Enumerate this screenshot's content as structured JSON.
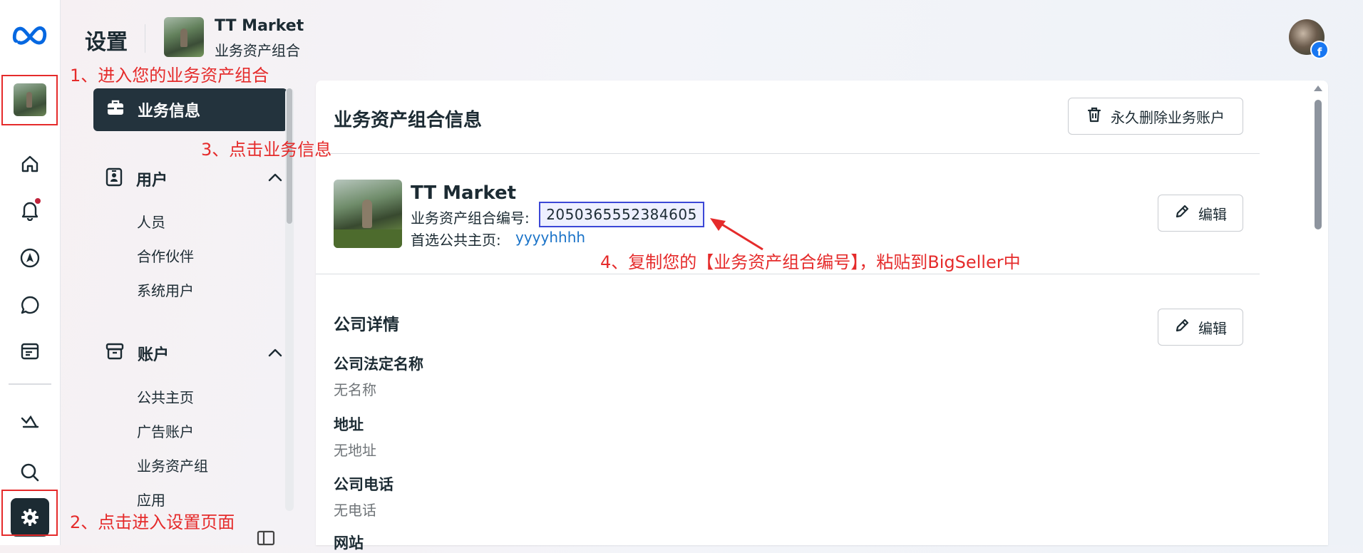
{
  "header": {
    "title": "设置",
    "business_name": "TT Market",
    "business_subtitle": "业务资产组合"
  },
  "settings_nav": {
    "active_item": "业务信息",
    "sections": [
      {
        "title": "用户",
        "items": [
          "人员",
          "合作伙伴",
          "系统用户"
        ]
      },
      {
        "title": "账户",
        "items": [
          "公共主页",
          "广告账户",
          "业务资产组",
          "应用"
        ]
      }
    ]
  },
  "card": {
    "title": "业务资产组合信息",
    "delete_button": "永久删除业务账户",
    "business_name": "TT Market",
    "id_label": "业务资产组合编号:",
    "id_value": "2050365552384605",
    "page_label": "首选公共主页:",
    "page_value": "yyyyhhhh",
    "edit_label": "编辑",
    "company_section_title": "公司详情",
    "fields": [
      {
        "label": "公司法定名称",
        "value": "无名称"
      },
      {
        "label": "地址",
        "value": "无地址"
      },
      {
        "label": "公司电话",
        "value": "无电话"
      },
      {
        "label": "网站",
        "value": ""
      }
    ]
  },
  "annotations": {
    "step1": "1、进入您的业务资产组合",
    "step2": "2、点击进入设置页面",
    "step3": "3、点击业务信息",
    "step4": "4、复制您的【业务资产组合编号】，粘贴到BigSeller中"
  },
  "colors": {
    "accent_dark": "#23333d",
    "annotation_red": "#e52b2b",
    "id_highlight_border": "#3b47d6",
    "link_blue": "#1a73c8",
    "notification_dot": "#c0233b",
    "meta_blue": "#0668e1"
  },
  "icons": {
    "logo": "meta-logo-icon",
    "rail": [
      "home-icon",
      "bell-icon",
      "navigation-icon",
      "chat-icon",
      "billing-icon",
      "reports-icon",
      "search-icon",
      "gear-icon"
    ],
    "nav": [
      "briefcase-icon",
      "id-badge-icon",
      "archive-icon",
      "chevron-up-icon"
    ],
    "actions": [
      "trash-icon",
      "pencil-icon"
    ]
  }
}
